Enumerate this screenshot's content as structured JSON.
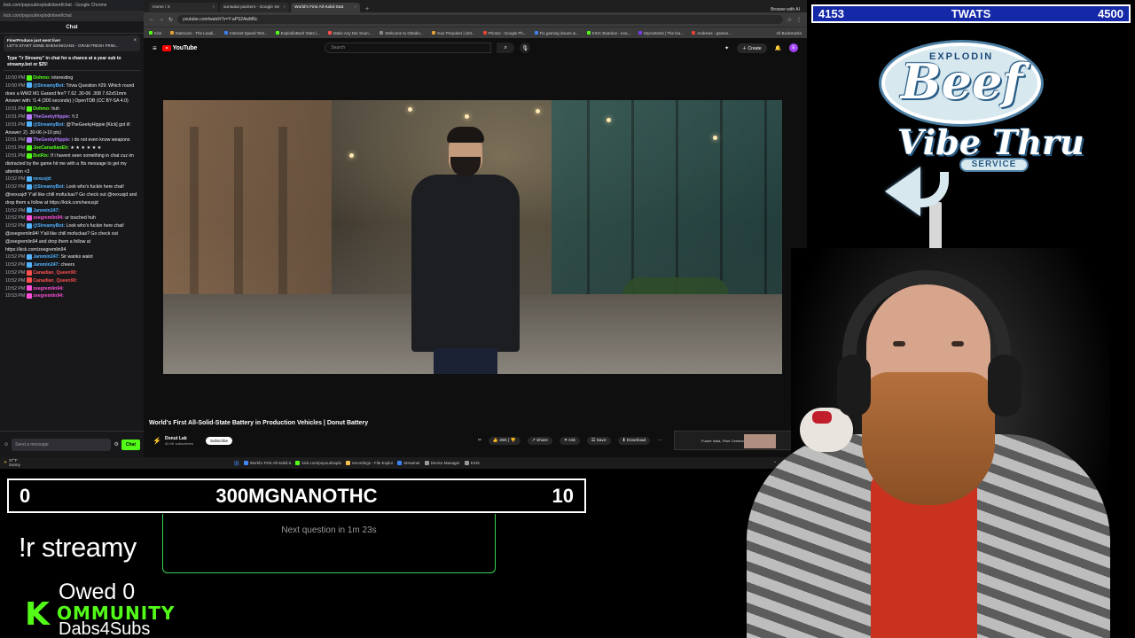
{
  "chat": {
    "window_title": "kick.com/popout/explodinbeef/chat - Google Chrome",
    "url": "kick.com/popout/explodinbeef/chat",
    "title": "Chat",
    "notice_title": "FinerProduce just went live!",
    "notice_body": "LET'S START SOME SHENANIGANS - GRAB FRESH FRIM...",
    "pinned": "Type \"!r Streamy\" in chat for a chance at a year sub to streamy.bot or $25!",
    "messages": [
      {
        "time": "10:50 PM",
        "user": "Dohmo:",
        "color": "#53fc18",
        "text": "interesting"
      },
      {
        "time": "10:50 PM",
        "user": "@StreamyBot:",
        "color": "#53b4ff",
        "text": "Trivia Question #29: Which round does a WW2 M1 Garand fire? 7.62 .30-06 .308 7.62x51mm Answer with: !1-4 (300 seconds) | OpenTDB (CC BY-SA 4.0)"
      },
      {
        "time": "10:51 PM",
        "user": "Dohmo:",
        "color": "#53fc18",
        "text": "huh"
      },
      {
        "time": "10:51 PM",
        "user": "TheGeekyHippie:",
        "color": "#b47cff",
        "text": "!t 2"
      },
      {
        "time": "10:51 PM",
        "user": "@StreamyBot:",
        "color": "#53b4ff",
        "text": "@TheGeekyHippie [Kick] got it! Answer: 2) .30-06 (+10 pts)"
      },
      {
        "time": "10:51 PM",
        "user": "TheGeekyHippie:",
        "color": "#b47cff",
        "text": "i do not even know weapons"
      },
      {
        "time": "10:51 PM",
        "user": "JoeCanadianEh:",
        "color": "#53fc18",
        "text": "★ ★ ★ ★ ★ ★"
      },
      {
        "time": "10:51 PM",
        "user": "BotRix:",
        "color": "#53fc18",
        "text": "If i havent seen something in chat cuz im distracted by the game hit me with a !tts message to get my attention <3"
      },
      {
        "time": "10:52 PM",
        "user": "nexusjd:",
        "color": "#53b4ff",
        "text": ""
      },
      {
        "time": "10:52 PM",
        "user": "@StreamyBot:",
        "color": "#53b4ff",
        "text": "Look who's fuckin here chat! @nexusjd! Y'all like chill mofuckas? Go check out @nexusjd and drop them a follow at https://kick.com/nexusjd"
      },
      {
        "time": "10:52 PM",
        "user": "Jammin247:",
        "color": "#53b4ff",
        "text": ""
      },
      {
        "time": "10:52 PM",
        "user": "zeegremlin94:",
        "color": "#ff4fd8",
        "text": "ur touched huh"
      },
      {
        "time": "10:52 PM",
        "user": "@StreamyBot:",
        "color": "#53b4ff",
        "text": "Look who's fuckin here chat! @zeegremlin94! Y'all like chill mofuckas? Go check out @zeegremlin94 and drop them a follow at https://kick.com/zeegremlin94"
      },
      {
        "time": "10:52 PM",
        "user": "Jammin247:",
        "color": "#53b4ff",
        "text": "Sir wanks walot"
      },
      {
        "time": "10:52 PM",
        "user": "Jammin247:",
        "color": "#53b4ff",
        "text": "cheers"
      },
      {
        "time": "10:52 PM",
        "user": "Canadian_Queen90:",
        "color": "#ff4f4f",
        "text": ""
      },
      {
        "time": "10:52 PM",
        "user": "Canadian_Queen90:",
        "color": "#ff4f4f",
        "text": ""
      },
      {
        "time": "10:52 PM",
        "user": "zeegremlin94:",
        "color": "#ff4fd8",
        "text": ""
      },
      {
        "time": "10:53 PM",
        "user": "zeegremlin94:",
        "color": "#ff4fd8",
        "text": ""
      }
    ],
    "input_placeholder": "Send a message",
    "send_label": "Chat"
  },
  "browser": {
    "tabs": [
      {
        "label": "Home / X",
        "active": false
      },
      {
        "label": "sunsalut painters - Google Se",
        "active": false
      },
      {
        "label": "World's First All-Solid-Stat",
        "active": true
      }
    ],
    "gemini_label": "Browse with AI",
    "url": "youtube.com/watch?v=Y-aPS2AwM6c",
    "bookmarks": [
      {
        "label": "Kick",
        "color": "#53fc18"
      },
      {
        "label": "Statscurs - The Leadi...",
        "color": "#e0a030"
      },
      {
        "label": "Internet Speed Test...",
        "color": "#3b82f6"
      },
      {
        "label": "ExplodinBeef Stats |...",
        "color": "#53fc18"
      },
      {
        "label": "Make Any Mic Soun...",
        "color": "#ff4f4f"
      },
      {
        "label": "Welcome to Oktabo...",
        "color": "#888"
      },
      {
        "label": "Your Prepoker | clet...",
        "color": "#e0a030"
      },
      {
        "label": "Photos - Google Ph...",
        "color": "#ea4335"
      },
      {
        "label": "Fix gaming issues w...",
        "color": "#3b82f6"
      },
      {
        "label": "KICK Boardox - eva...",
        "color": "#53fc18"
      },
      {
        "label": "Mysosteels | The lea...",
        "color": "#7c3aed"
      },
      {
        "label": "Andrews - games...",
        "color": "#ea4335"
      }
    ],
    "all_bookmarks": "All Bookmarks"
  },
  "youtube": {
    "logo_text": "YouTube",
    "search_placeholder": "Search",
    "create_label": "Create",
    "avatar_letter": "E",
    "video_title": "World's First All-Solid-State Battery in Production Vehicles | Donut Battery",
    "channel_name": "Donut Lab",
    "channel_subs": "40.4K subscribers",
    "subscribe_label": "Subscribe",
    "likes": "25K",
    "share_label": "Share",
    "ask_label": "Ask",
    "save_label": "Save",
    "download_label": "Download",
    "ad_text": "Future India, Finer Centers"
  },
  "taskbar": {
    "temp": "37°F",
    "weather": "Sunny",
    "apps": [
      {
        "label": "World's First All-Solid-S",
        "color": "#4285f4"
      },
      {
        "label": "kick.com/popout/explo",
        "color": "#53fc18"
      },
      {
        "label": "recordings - File Explor",
        "color": "#f2c14e"
      },
      {
        "label": "Streamer",
        "color": "#3b82f6"
      },
      {
        "label": "Device Manager",
        "color": "#999"
      },
      {
        "label": "KSIX",
        "color": "#999"
      }
    ]
  },
  "overlay": {
    "top_left": "4153",
    "top_center": "TWATS",
    "top_right": "4500",
    "trivia_left": "0",
    "trivia_center": "300MGNANOTHC",
    "trivia_right": "10",
    "next_question": "Next question in 1m 23s",
    "command": "!r streamy",
    "owed": "Owed 0",
    "kick_k": "K",
    "community": "OMMUNITY",
    "dabs": "Dabs4Subs"
  },
  "logo": {
    "explodin": "EXPLODIN",
    "beef": "Beef",
    "vibe": "Vibe Thru",
    "service": "SERVICE"
  }
}
